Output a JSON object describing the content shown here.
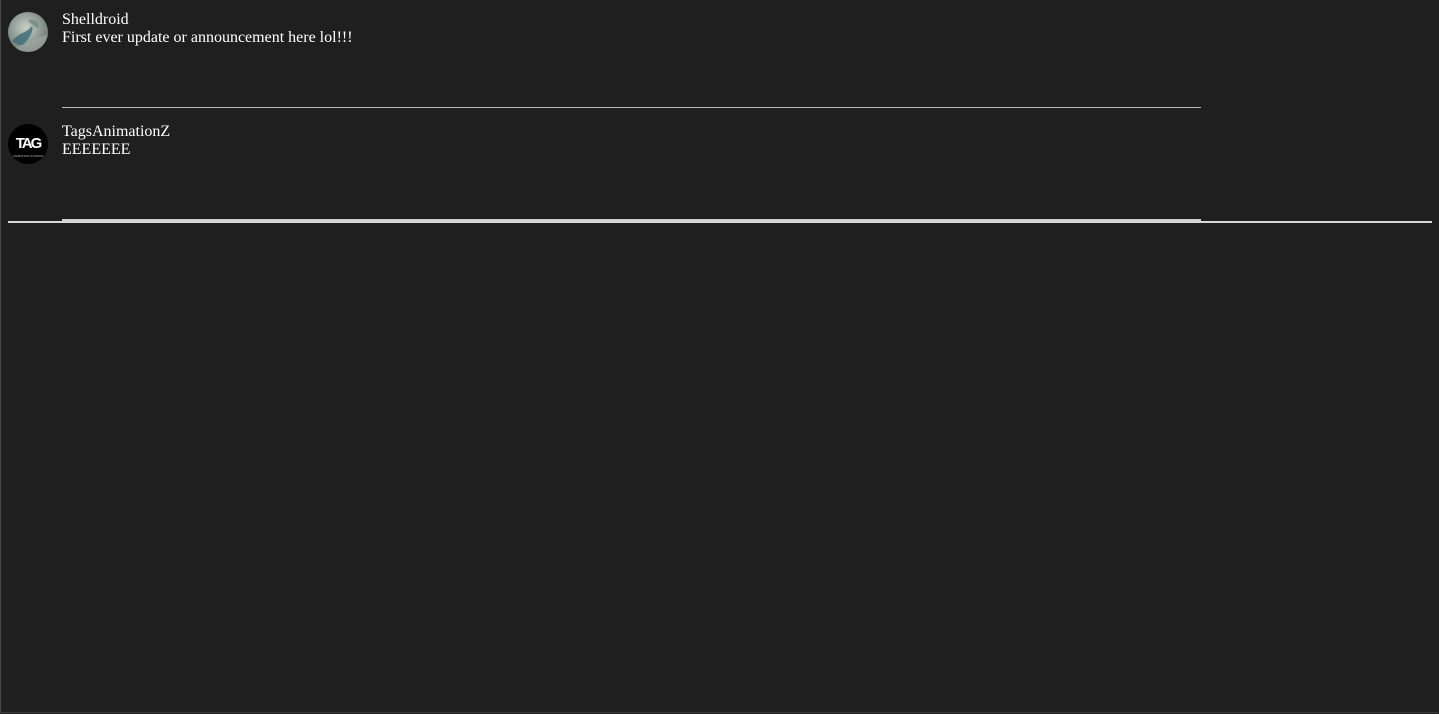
{
  "feed": {
    "posts": [
      {
        "author": "Shelldroid",
        "message": "First ever update or announcement here lol!!!",
        "avatar_icon": "shelldroid-avatar-icon"
      },
      {
        "author": "TagsAnimationZ",
        "message": "EEEEEEE",
        "avatar_icon": "tag-logo-avatar-icon",
        "avatar_logo_text": "TAG",
        "avatar_logo_subtext": "ANIMATION STUDIOS"
      }
    ]
  },
  "colors": {
    "background": "#1f1f1f",
    "text": "#ffffff",
    "separator": "#bdbdbd"
  }
}
